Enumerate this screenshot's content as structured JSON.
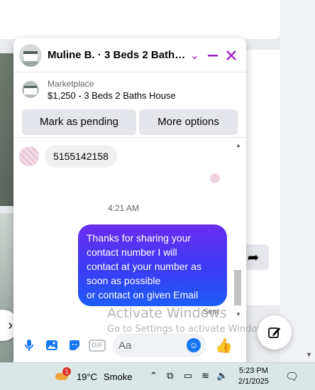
{
  "chat": {
    "title": "Muline B. · 3 Beds 2 Baths ...",
    "listing": {
      "label": "Marketplace",
      "price_title": "$1,250 - 3 Beds 2 Baths House"
    },
    "actions": {
      "mark_pending": "Mark as pending",
      "more_options": "More options"
    },
    "messages": {
      "incoming": "5155142158",
      "timestamp": "4:21 AM",
      "outgoing_lines": [
        "Thanks for sharing your",
        "contact number I will",
        "contact at your number as",
        "soon as possible",
        "or contact on given  Email"
      ],
      "status": "Sent"
    },
    "composer": {
      "placeholder": "Aa",
      "gif_label": "GIF"
    }
  },
  "watermark": {
    "title": "Activate Windows",
    "subtitle": "Go to Settings to activate Windows."
  },
  "taskbar": {
    "weather_badge": "1",
    "temperature": "19°C",
    "condition": "Smoke",
    "time": "5:23 PM",
    "date": "2/1/2025"
  },
  "colors": {
    "accent": "#a020c8",
    "messenger_blue": "#1877f2",
    "bubble_gradient_top": "#6a2cf0",
    "bubble_gradient_bottom": "#1d5cf6"
  }
}
